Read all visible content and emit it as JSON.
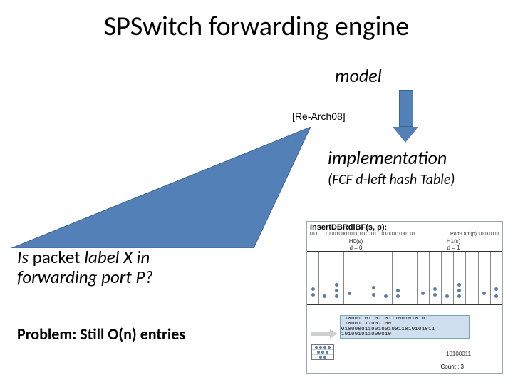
{
  "title": "SPSwitch forwarding engine",
  "model_label": "model",
  "citation": "[Re-Arch08]",
  "impl_label": "implementation",
  "impl_sub": "(FCF d-left hash Table)",
  "question_italic_1": "Is",
  "question_regular_1": " packet ",
  "question_italic_2": "label X in forwarding port P?",
  "problem": "Problem: Still O(n) entries",
  "figure": {
    "header": "InsertDBRdlBF(s, p):",
    "topright_label": "Port-Out (p)",
    "topright_bits": "10010111",
    "topleft_bits": "011 ... 100010001011011010111010010100110",
    "d_labels": [
      "d = 0",
      "d = 1"
    ],
    "hash_labels": [
      "H0(s)",
      "H1(s)"
    ],
    "bitrows": [
      "1100011011011011100101010",
      "110001111001100",
      "0100000110010010011010101011",
      "101001011000010"
    ],
    "count_label": "Count : 3",
    "portout_bits": "10100011"
  }
}
